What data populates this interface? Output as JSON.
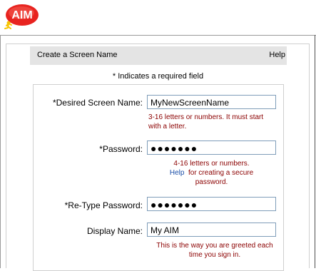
{
  "brand": {
    "logo_text": "AIM",
    "logo_color": "#e8231f"
  },
  "header": {
    "title": "Create a Screen Name",
    "help": "Help"
  },
  "required_note": "* Indicates a required field",
  "form": {
    "screen_name": {
      "label": "*Desired Screen Name:",
      "value": "MyNewScreenName",
      "hint_line1": "3-16 letters or numbers. It must start",
      "hint_line2": "with a letter."
    },
    "password": {
      "label": "*Password:",
      "value": "●●●●●●●",
      "hint_line1": "4-16 letters or numbers.",
      "hint_link": "Help",
      "hint_line2_rest": "for creating a secure",
      "hint_line3": "password."
    },
    "retype_password": {
      "label": "*Re-Type Password:",
      "value": "●●●●●●●"
    },
    "display_name": {
      "label": "Display Name:",
      "value": "My AIM",
      "hint_line1": "This is the way you are greeted each",
      "hint_line2": "time you sign in."
    }
  }
}
